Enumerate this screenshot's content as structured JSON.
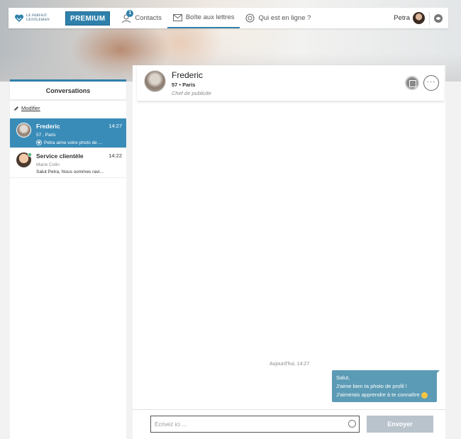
{
  "nav": {
    "logo_line1": "LE PARFAIT",
    "logo_line2": "GENTLEMAN",
    "premium_label": "PREMIUM",
    "contacts_label": "Contacts",
    "contacts_badge": "1",
    "mailbox_label": "Boîte aux lettres",
    "online_label": "Qui est en ligne ?",
    "user_name": "Petra",
    "accent_color": "#2f80ab"
  },
  "sidebar": {
    "tab_label": "Conversations",
    "modify_label": "Modifier",
    "conversations": [
      {
        "name": "Frederic",
        "time": "14:27",
        "subtitle": "57 , Paris",
        "preview": "Petra aime votre photo de ...",
        "active": true
      },
      {
        "name": "Service clientèle",
        "time": "14:22",
        "subtitle": "Marie Colin",
        "preview": "Salut Petra, Nous sommes ravi...",
        "active": false
      }
    ]
  },
  "chat": {
    "name": "Frederic",
    "age_city": "57 • Paris",
    "job": "Chef de publicite",
    "date_label": "Aujourd'hui, 14:27",
    "message_lines": [
      "Salut,",
      "J'aime bien ta photo de profil !",
      "J'aimerais apprendre à te connaître"
    ],
    "input_placeholder": "Écrivez ici ...",
    "send_label": "Envoyer",
    "more_glyph": "···"
  }
}
